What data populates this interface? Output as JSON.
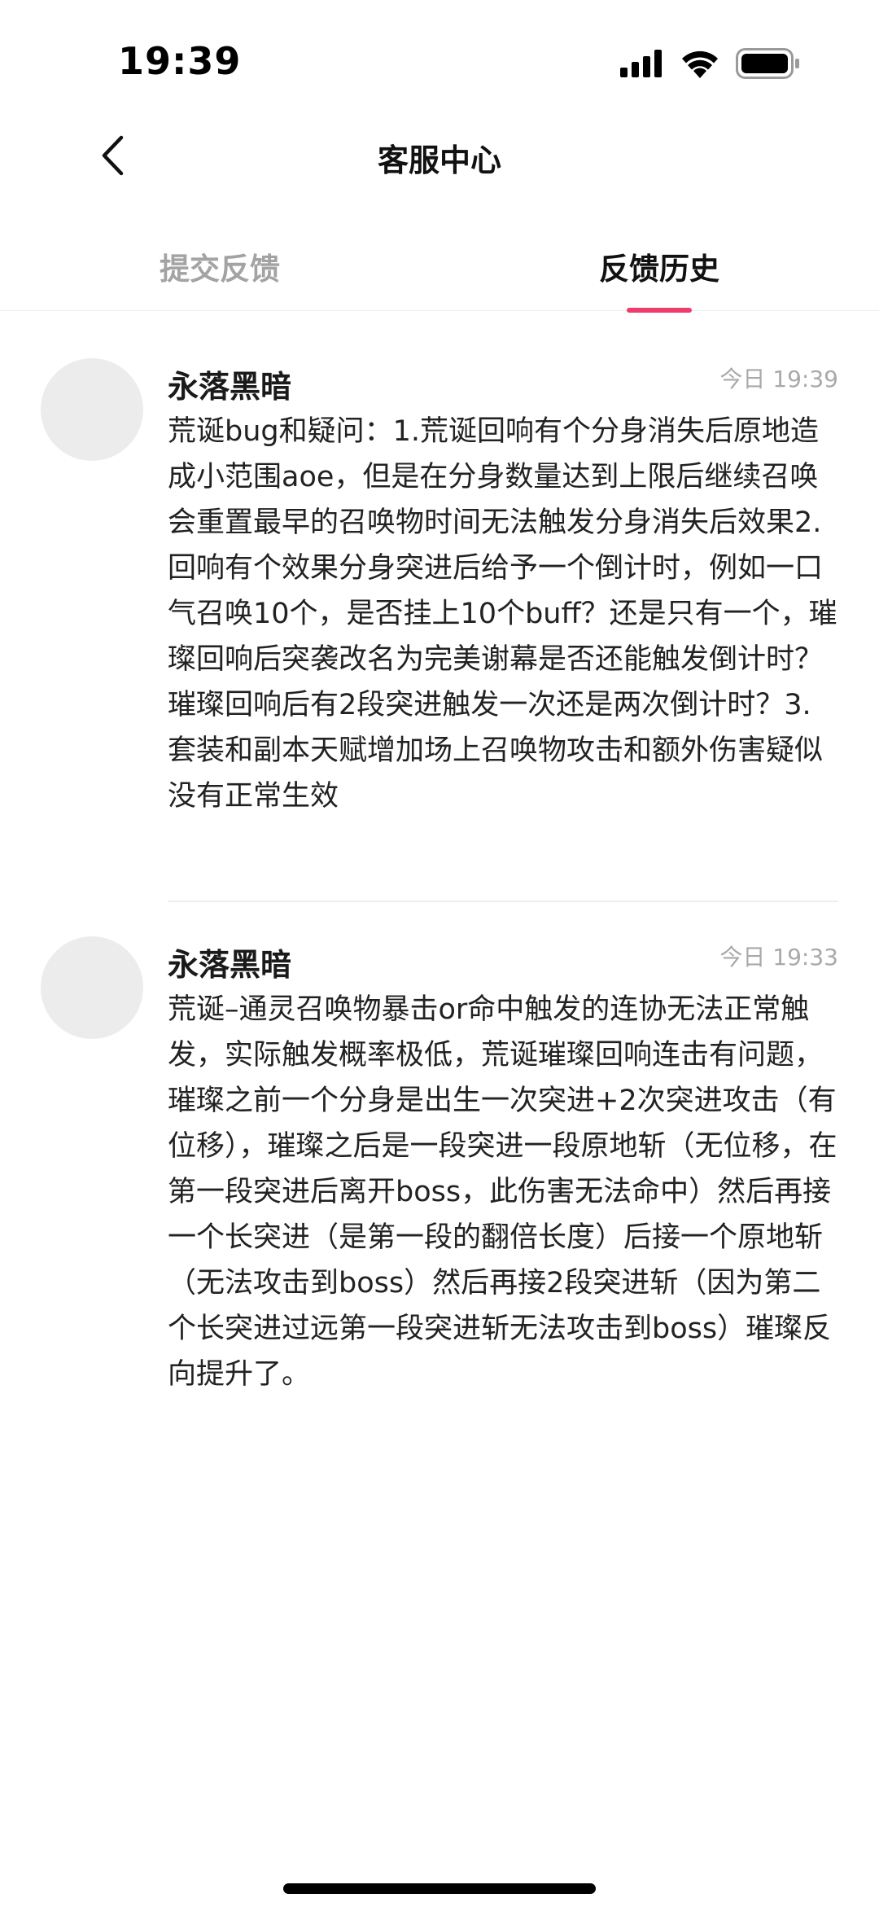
{
  "status_bar": {
    "time": "19:39",
    "icons": [
      "cellular-signal-icon",
      "wifi-icon",
      "battery-icon"
    ]
  },
  "nav": {
    "title": "客服中心",
    "back_icon": "chevron-left-icon"
  },
  "tabs": [
    {
      "label": "提交反馈",
      "active": false
    },
    {
      "label": "反馈历史",
      "active": true
    }
  ],
  "colors": {
    "accent": "#ee3c6c",
    "inactive_tab": "#a3a3a3",
    "timestamp": "#a9a9a9",
    "avatar_placeholder": "#ececec"
  },
  "feedback_items": [
    {
      "user": "永落黑暗",
      "time": "今日 19:39",
      "content": "荒诞bug和疑问：1.荒诞回响有个分身消失后原地造成小范围aoe，但是在分身数量达到上限后继续召唤会重置最早的召唤物时间无法触发分身消失后效果2.回响有个效果分身突进后给予一个倒计时，例如一口气召唤10个，是否挂上10个buff？还是只有一个，璀璨回响后突袭改名为完美谢幕是否还能触发倒计时？璀璨回响后有2段突进触发一次还是两次倒计时？3.套装和副本天赋增加场上召唤物攻击和额外伤害疑似没有正常生效"
    },
    {
      "user": "永落黑暗",
      "time": "今日 19:33",
      "content": "荒诞–通灵召唤物暴击or命中触发的连协无法正常触发，实际触发概率极低，荒诞璀璨回响连击有问题，璀璨之前一个分身是出生一次突进+2次突进攻击（有位移），璀璨之后是一段突进一段原地斩（无位移，在第一段突进后离开boss，此伤害无法命中）然后再接一个长突进（是第一段的翻倍长度）后接一个原地斩（无法攻击到boss）然后再接2段突进斩（因为第二个长突进过远第一段突进斩无法攻击到boss）璀璨反向提升了。"
    }
  ]
}
